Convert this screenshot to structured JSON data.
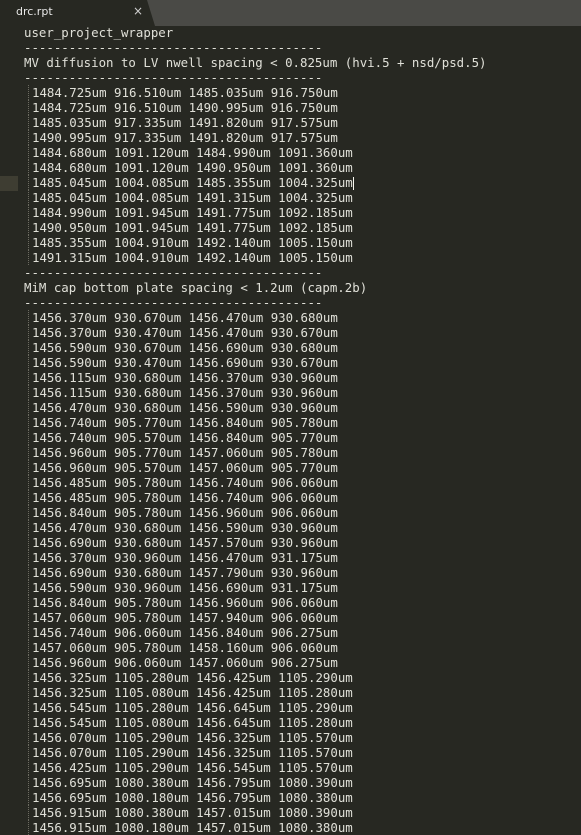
{
  "tab": {
    "title": "drc.rpt",
    "close_glyph": "×"
  },
  "header": "user_project_wrapper",
  "separator": "----------------------------------------",
  "sections": [
    {
      "title": "MV diffusion to LV nwell spacing < 0.825um (hvi.5 + nsd/psd.5)",
      "rows": [
        "1484.725um 916.510um 1485.035um 916.750um",
        "1484.725um 916.510um 1490.995um 916.750um",
        "1485.035um 917.335um 1491.820um 917.575um",
        "1490.995um 917.335um 1491.820um 917.575um",
        "1484.680um 1091.120um 1484.990um 1091.360um",
        "1484.680um 1091.120um 1490.950um 1091.360um",
        "1485.045um 1004.085um 1485.355um 1004.325um",
        "1485.045um 1004.085um 1491.315um 1004.325um",
        "1484.990um 1091.945um 1491.775um 1092.185um",
        "1490.950um 1091.945um 1491.775um 1092.185um",
        "1485.355um 1004.910um 1492.140um 1005.150um",
        "1491.315um 1004.910um 1492.140um 1005.150um"
      ]
    },
    {
      "title": "MiM cap bottom plate spacing < 1.2um (capm.2b)",
      "rows": [
        "1456.370um 930.670um 1456.470um 930.680um",
        "1456.370um 930.470um 1456.470um 930.670um",
        "1456.590um 930.670um 1456.690um 930.680um",
        "1456.590um 930.470um 1456.690um 930.670um",
        "1456.115um 930.680um 1456.370um 930.960um",
        "1456.115um 930.680um 1456.370um 930.960um",
        "1456.470um 930.680um 1456.590um 930.960um",
        "1456.740um 905.770um 1456.840um 905.780um",
        "1456.740um 905.570um 1456.840um 905.770um",
        "1456.960um 905.770um 1457.060um 905.780um",
        "1456.960um 905.570um 1457.060um 905.770um",
        "1456.485um 905.780um 1456.740um 906.060um",
        "1456.485um 905.780um 1456.740um 906.060um",
        "1456.840um 905.780um 1456.960um 906.060um",
        "1456.470um 930.680um 1456.590um 930.960um",
        "1456.690um 930.680um 1457.570um 930.960um",
        "1456.370um 930.960um 1456.470um 931.175um",
        "1456.690um 930.680um 1457.790um 930.960um",
        "1456.590um 930.960um 1456.690um 931.175um",
        "1456.840um 905.780um 1456.960um 906.060um",
        "1457.060um 905.780um 1457.940um 906.060um",
        "1456.740um 906.060um 1456.840um 906.275um",
        "1457.060um 905.780um 1458.160um 906.060um",
        "1456.960um 906.060um 1457.060um 906.275um",
        "1456.325um 1105.280um 1456.425um 1105.290um",
        "1456.325um 1105.080um 1456.425um 1105.280um",
        "1456.545um 1105.280um 1456.645um 1105.290um",
        "1456.545um 1105.080um 1456.645um 1105.280um",
        "1456.070um 1105.290um 1456.325um 1105.570um",
        "1456.070um 1105.290um 1456.325um 1105.570um",
        "1456.425um 1105.290um 1456.545um 1105.570um",
        "1456.695um 1080.380um 1456.795um 1080.390um",
        "1456.695um 1080.180um 1456.795um 1080.380um",
        "1456.915um 1080.380um 1457.015um 1080.390um",
        "1456.915um 1080.180um 1457.015um 1080.380um"
      ]
    }
  ]
}
